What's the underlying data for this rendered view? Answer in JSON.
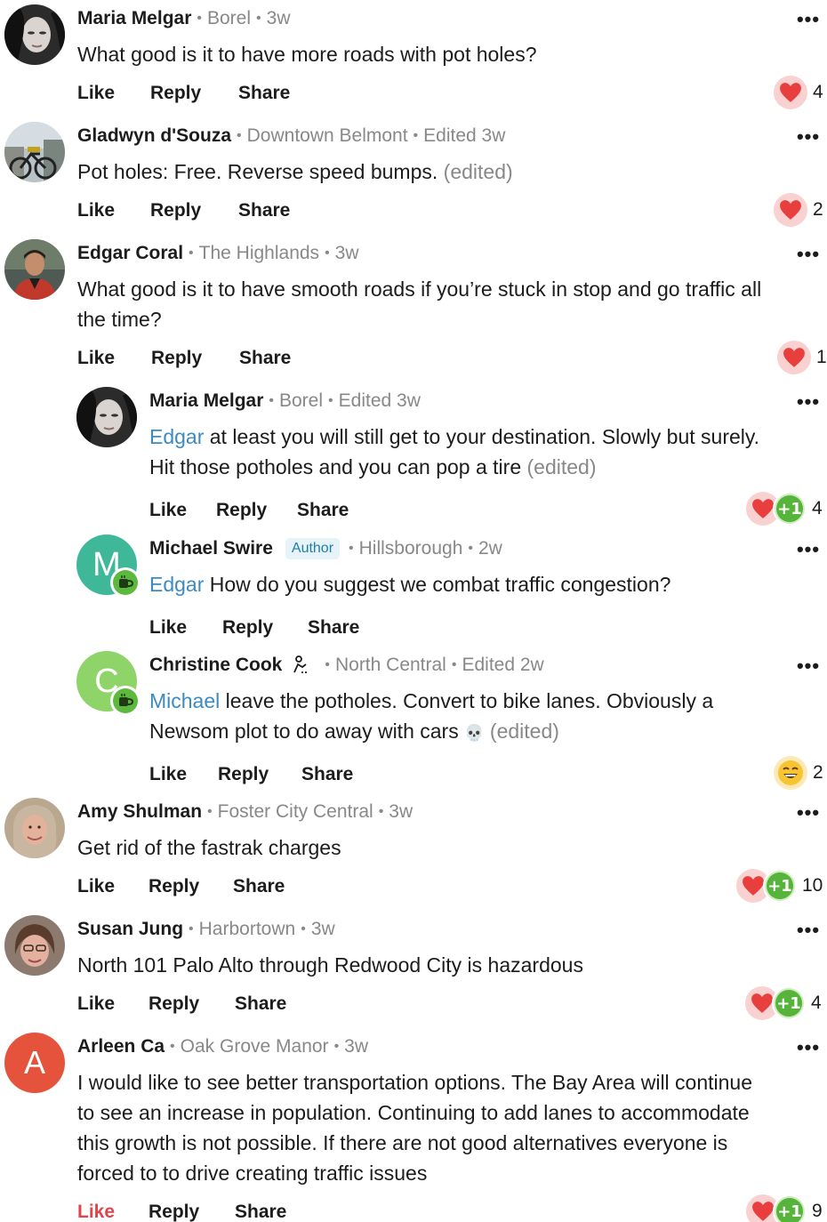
{
  "ui": {
    "more_label": "•••",
    "like_label": "Like",
    "reply_label": "Reply",
    "share_label": "Share",
    "author_badge": "Author",
    "edited_label": "(edited)",
    "plus_one": "+1"
  },
  "colors": {
    "accent_link": "#3b8ac4",
    "liked": "#e0454b",
    "heart": "#e83e3e",
    "plus_one_green": "#56b43b"
  },
  "comments": [
    {
      "name": "Maria Melgar",
      "neighborhood": "Borel",
      "time": "3w",
      "avatar_kind": "photo",
      "text": "What good is it to have more roads with pot holes?",
      "edited": false,
      "reactions": [
        "heart"
      ],
      "count": "4"
    },
    {
      "name": "Gladwyn d'Souza",
      "neighborhood": "Downtown Belmont",
      "time": "Edited 3w",
      "avatar_kind": "photo",
      "text": "Pot holes: Free. Reverse speed bumps.",
      "edited": true,
      "reactions": [
        "heart"
      ],
      "count": "2"
    },
    {
      "name": "Edgar Coral",
      "neighborhood": "The Highlands",
      "time": "3w",
      "avatar_kind": "photo",
      "text_line1": "What good is it to have smooth roads if you’re stuck in stop and go traffic all",
      "text_line2": "the time?",
      "edited": false,
      "reactions": [
        "heart"
      ],
      "count": "1"
    },
    {
      "name": "Maria Melgar",
      "neighborhood": "Borel",
      "time": "Edited 3w",
      "avatar_kind": "photo",
      "mention": "Edgar",
      "text_line1": " at least you will still get to your destination. Slowly but surely.",
      "text_line2": "Hit those  potholes and you can pop a tire",
      "edited": true,
      "reactions": [
        "heart",
        "plus-one"
      ],
      "count": "4"
    },
    {
      "name": "Michael Swire",
      "neighborhood": "Hillsborough",
      "time": "2w",
      "avatar_kind": "initial",
      "avatar_letter": "M",
      "avatar_color": "#3fb89a",
      "mention": "Edgar",
      "text": " How do you suggest we combat traffic congestion?",
      "edited": false,
      "reactions": [],
      "count": ""
    },
    {
      "name": "Christine Cook",
      "neighborhood": "North Central",
      "time": "Edited 2w",
      "avatar_kind": "initial",
      "avatar_letter": "C",
      "avatar_color": "#8fd468",
      "mention": "Michael",
      "text_line1": " leave the potholes. Convert to bike lanes. Obviously a",
      "text_line2": "Newsom plot to do away with cars ",
      "skull": "💀",
      "edited": true,
      "reactions": [
        "grin"
      ],
      "count": "2"
    },
    {
      "name": "Amy Shulman",
      "neighborhood": "Foster City Central",
      "time": "3w",
      "avatar_kind": "photo",
      "text": "Get rid of the fastrak charges",
      "edited": false,
      "reactions": [
        "heart",
        "plus-one"
      ],
      "count": "10"
    },
    {
      "name": "Susan Jung",
      "neighborhood": "Harbortown",
      "time": "3w",
      "avatar_kind": "photo",
      "text": "North 101 Palo Alto through Redwood City is hazardous",
      "edited": false,
      "reactions": [
        "heart",
        "plus-one"
      ],
      "count": "4"
    },
    {
      "name": "Arleen Ca",
      "neighborhood": "Oak Grove Manor",
      "time": "3w",
      "avatar_kind": "initial",
      "avatar_letter": "A",
      "avatar_color": "#e5533d",
      "text_line1": "I would like to see better transportation options.   The Bay Area will continue",
      "text_line2": "to see an increase in population.   Continuing to add lanes to accommodate",
      "text_line3": "this growth is not possible.   If there are not good alternatives everyone is",
      "text_line4": "forced to to drive creating traffic issues",
      "edited": false,
      "liked_by_viewer": true,
      "reactions": [
        "heart",
        "plus-one"
      ],
      "count": "9"
    }
  ]
}
